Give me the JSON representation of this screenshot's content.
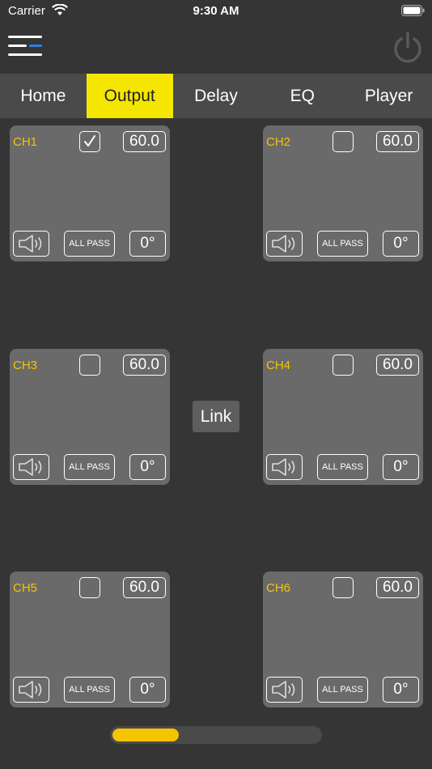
{
  "status_bar": {
    "carrier": "Carrier",
    "time": "9:30 AM"
  },
  "tabs": [
    {
      "label": "Home",
      "active": false
    },
    {
      "label": "Output",
      "active": true
    },
    {
      "label": "Delay",
      "active": false
    },
    {
      "label": "EQ",
      "active": false
    },
    {
      "label": "Player",
      "active": false
    }
  ],
  "channels": [
    {
      "label": "CH1",
      "checked": true,
      "value": "60.0",
      "allpass": "ALL PASS",
      "phase": "0°"
    },
    {
      "label": "CH2",
      "checked": false,
      "value": "60.0",
      "allpass": "ALL PASS",
      "phase": "0°"
    },
    {
      "label": "CH3",
      "checked": false,
      "value": "60.0",
      "allpass": "ALL PASS",
      "phase": "0°"
    },
    {
      "label": "CH4",
      "checked": false,
      "value": "60.0",
      "allpass": "ALL PASS",
      "phase": "0°"
    },
    {
      "label": "CH5",
      "checked": false,
      "value": "60.0",
      "allpass": "ALL PASS",
      "phase": "0°"
    },
    {
      "label": "CH6",
      "checked": false,
      "value": "60.0",
      "allpass": "ALL PASS",
      "phase": "0°"
    }
  ],
  "link_label": "Link",
  "scroll_progress": 0.32,
  "icons": {
    "menu": "menu-icon",
    "power": "power-icon",
    "speaker": "speaker-icon",
    "check": "checkmark-icon"
  },
  "colors": {
    "background": "#353535",
    "card": "#6a6a6a",
    "tab_bar": "#4a4a4a",
    "active_tab": "#f5e600",
    "channel_label": "#f5c400",
    "scroll_fill": "#f5c400",
    "menu_accent": "#2f7de1"
  }
}
